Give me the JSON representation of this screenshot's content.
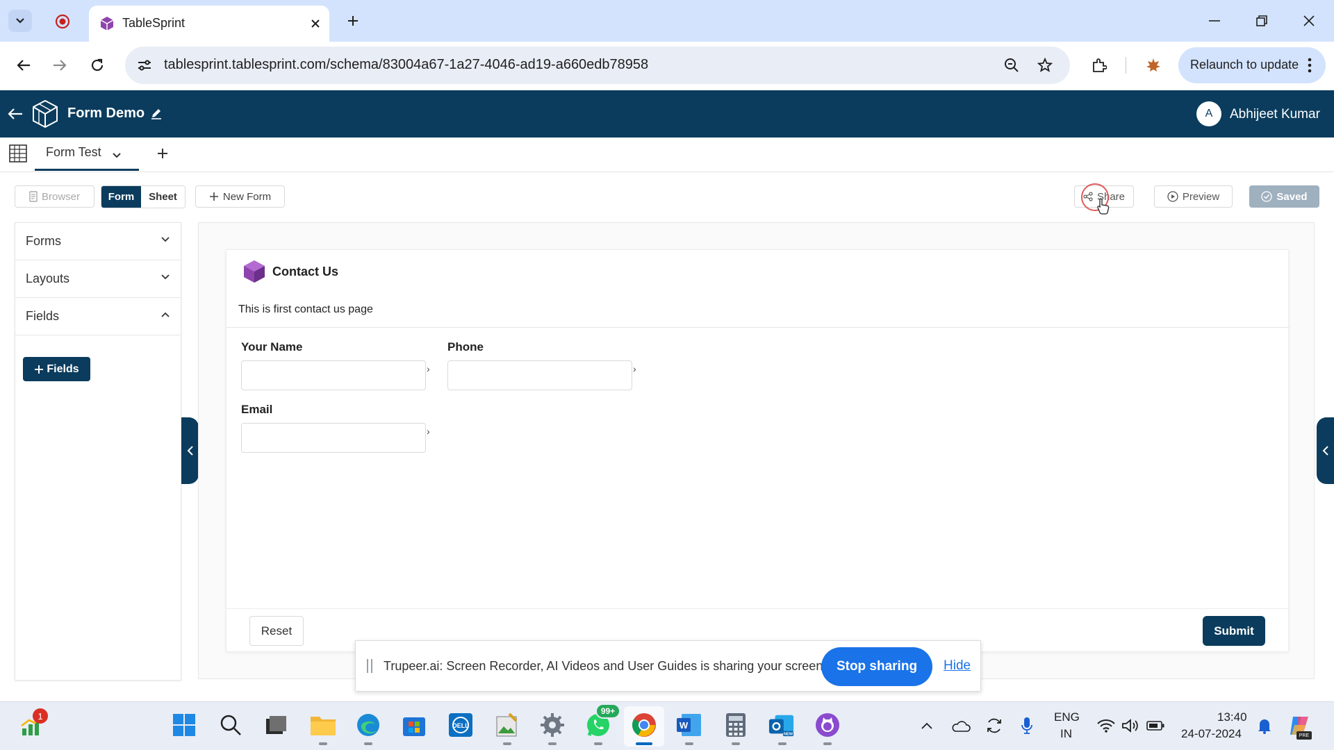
{
  "browser": {
    "tab_title": "TableSprint",
    "url": "tablesprint.tablesprint.com/schema/83004a67-1a27-4046-ad19-a660edb78958",
    "relaunch_label": "Relaunch to update"
  },
  "app": {
    "title": "Form Demo",
    "user_initial": "A",
    "user_name": "Abhijeet Kumar"
  },
  "sheet_tabs": {
    "active_label": "Form Test"
  },
  "toolbar": {
    "browser_label": "Browser",
    "form_label": "Form",
    "sheet_label": "Sheet",
    "new_form_label": "New Form",
    "share_label": "Share",
    "preview_label": "Preview",
    "saved_label": "Saved"
  },
  "sidebar": {
    "items": [
      {
        "label": "Forms"
      },
      {
        "label": "Layouts"
      },
      {
        "label": "Fields"
      }
    ],
    "fields_button": "Fields"
  },
  "form": {
    "title": "Contact Us",
    "description": "This is first contact us page",
    "fields": [
      {
        "label": "Your Name",
        "value": ""
      },
      {
        "label": "Phone",
        "value": ""
      },
      {
        "label": "Email",
        "value": ""
      }
    ],
    "reset_label": "Reset",
    "submit_label": "Submit"
  },
  "share_bar": {
    "message": "Trupeer.ai: Screen Recorder, AI Videos and User Guides is sharing your screen.",
    "stop_label": "Stop sharing",
    "hide_label": "Hide"
  },
  "taskbar": {
    "sheets_badge": "1",
    "whatsapp_badge": "99+",
    "language": "ENG",
    "region": "IN",
    "time": "13:40",
    "date": "24-07-2024"
  },
  "colors": {
    "brand": "#0b3c5d",
    "browser_accent": "#1a73e8",
    "tabstrip": "#d3e3fd"
  }
}
